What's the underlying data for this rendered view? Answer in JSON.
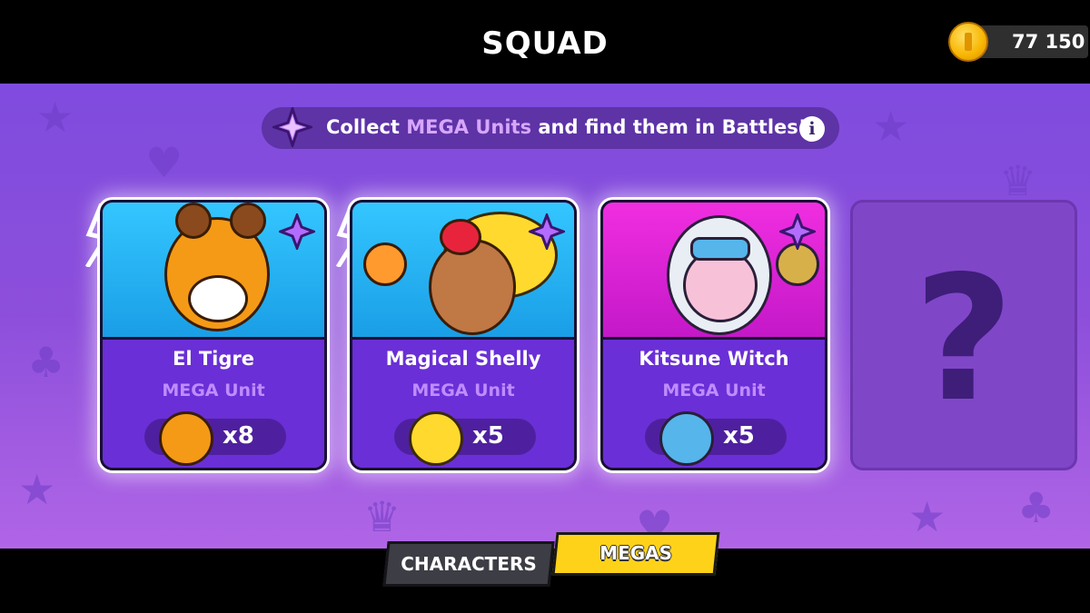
{
  "header": {
    "title": "SQUAD",
    "coins": "77 150"
  },
  "banner": {
    "pre": "Collect ",
    "highlight": "MEGA Units",
    "post": " and find them in Battles!",
    "info_glyph": "i"
  },
  "cards": [
    {
      "name": "El Tigre",
      "subtitle": "MEGA Unit",
      "count": "x8",
      "art_bg": "#27b6f2",
      "icon": "tiger-mask-icon"
    },
    {
      "name": "Magical Shelly",
      "subtitle": "MEGA Unit",
      "count": "x5",
      "art_bg": "#27b6f2",
      "icon": "shelly-face-icon"
    },
    {
      "name": "Kitsune Witch",
      "subtitle": "MEGA Unit",
      "count": "x5",
      "art_bg": "#e320d6",
      "icon": "kitsune-face-icon"
    }
  ],
  "locked_slot": {
    "glyph": "?"
  },
  "tabs": {
    "characters": "CHARACTERS",
    "megas": "MEGAS",
    "active": "MEGAS"
  },
  "colors": {
    "accent_purple": "#8d4fdb",
    "tab_active": "#ffd21a",
    "highlight_text": "#d8a6ff"
  }
}
